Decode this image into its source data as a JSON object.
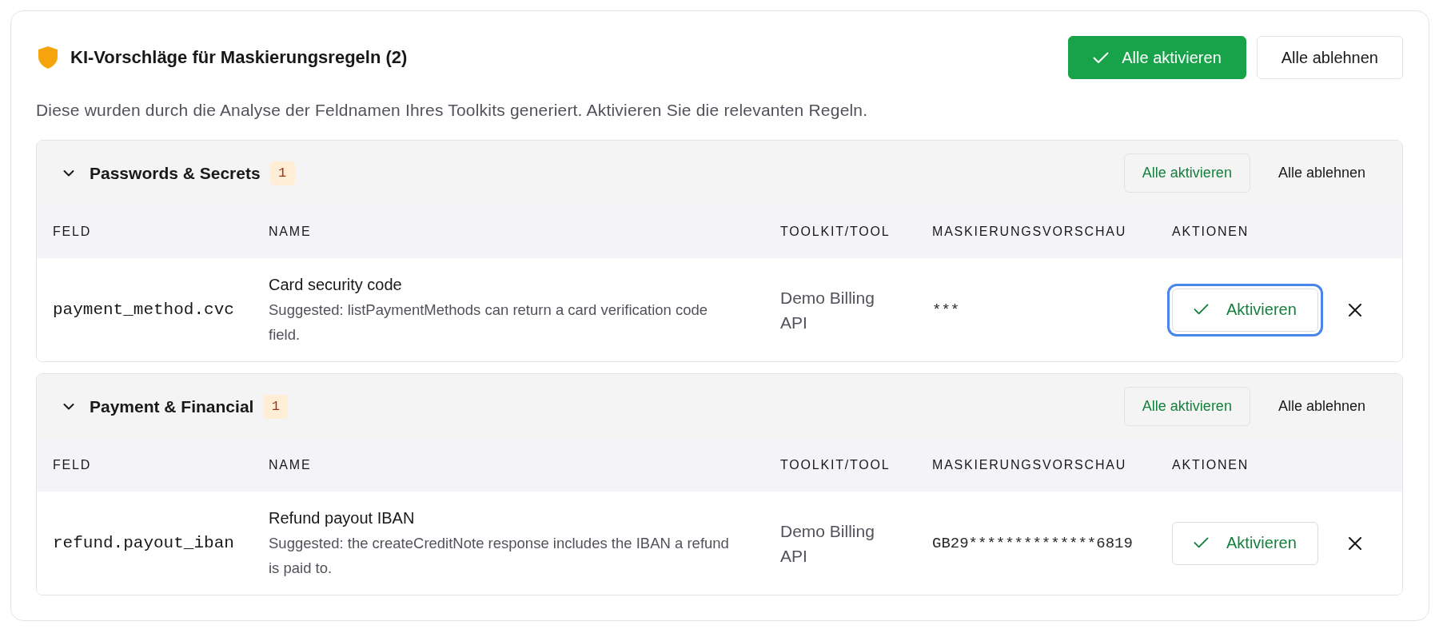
{
  "header": {
    "title": "KI-Vorschläge für Maskierungsregeln (2)",
    "actions": [
      {
        "kind": "primary",
        "label": "Alle aktivieren"
      },
      {
        "kind": "secondary",
        "label": "Alle ablehnen"
      }
    ]
  },
  "description": "Diese wurden durch die Analyse der Feldnamen Ihres Toolkits generiert. Aktivieren Sie die relevanten Regeln.",
  "groups": [
    {
      "title": "Passwords & Secrets",
      "count": "1",
      "expanded": true,
      "actions": [
        {
          "kind": "outline",
          "label": "Alle aktivieren"
        },
        {
          "kind": "plain",
          "label": "Alle ablehnen"
        }
      ],
      "columns": [
        "FELD",
        "NAME",
        "TOOLKIT/TOOL",
        "MASKIERUNGSVORSCHAU",
        "AKTIONEN"
      ],
      "rows": [
        {
          "field": "payment_method.cvc",
          "name": "Card security code",
          "suggestion": "Suggested: listPaymentMethods can return a card verification code field.",
          "toolkit": "Demo Billing API",
          "preview": "***",
          "activate": {
            "label": "Aktivieren",
            "focused": true
          }
        }
      ]
    },
    {
      "title": "Payment & Financial",
      "count": "1",
      "expanded": true,
      "actions": [
        {
          "kind": "outline",
          "label": "Alle aktivieren"
        },
        {
          "kind": "plain",
          "label": "Alle ablehnen"
        }
      ],
      "columns": [
        "FELD",
        "NAME",
        "TOOLKIT/TOOL",
        "MASKIERUNGSVORSCHAU",
        "AKTIONEN"
      ],
      "rows": [
        {
          "field": "refund.payout_iban",
          "name": "Refund payout IBAN",
          "suggestion": "Suggested: the createCreditNote response includes the IBAN a refund is paid to.",
          "toolkit": "Demo Billing API",
          "preview": "GB29**************6819",
          "activate": {
            "label": "Aktivieren",
            "focused": false
          }
        }
      ]
    }
  ]
}
